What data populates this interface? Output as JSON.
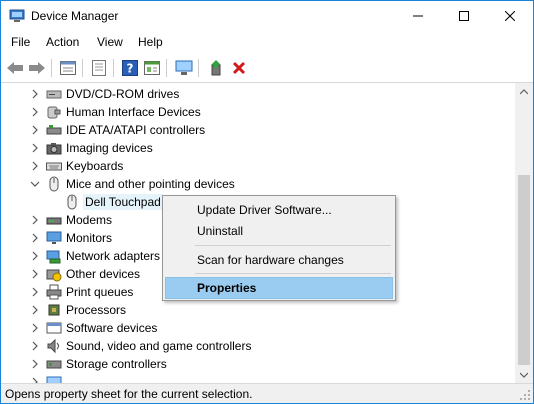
{
  "window": {
    "title": "Device Manager",
    "accent": "#1883d7"
  },
  "menubar": {
    "items": [
      "File",
      "Action",
      "View",
      "Help"
    ]
  },
  "toolbar": {
    "icons": [
      "back-arrow-icon",
      "forward-arrow-icon",
      "properties-sheet-icon",
      "device-list-icon",
      "help-icon",
      "view-icon",
      "scan-hardware-icon",
      "update-driver-icon",
      "uninstall-x-icon"
    ]
  },
  "tree": {
    "rows": [
      {
        "label": "DVD/CD-ROM drives",
        "expanded": false,
        "icon": "dvd-drive-icon"
      },
      {
        "label": "Human Interface Devices",
        "expanded": false,
        "icon": "hid-icon"
      },
      {
        "label": "IDE ATA/ATAPI controllers",
        "expanded": false,
        "icon": "ide-controller-icon"
      },
      {
        "label": "Imaging devices",
        "expanded": false,
        "icon": "camera-icon"
      },
      {
        "label": "Keyboards",
        "expanded": false,
        "icon": "keyboard-icon"
      },
      {
        "label": "Mice and other pointing devices",
        "expanded": true,
        "icon": "mouse-icon"
      },
      {
        "label": "Dell Touchpad",
        "child": true,
        "selected": true,
        "icon": "mouse-icon"
      },
      {
        "label": "Modems",
        "expanded": false,
        "icon": "modem-icon"
      },
      {
        "label": "Monitors",
        "expanded": false,
        "icon": "monitor-icon"
      },
      {
        "label": "Network adapters",
        "expanded": false,
        "icon": "network-adapter-icon"
      },
      {
        "label": "Other devices",
        "expanded": false,
        "icon": "other-devices-icon"
      },
      {
        "label": "Print queues",
        "expanded": false,
        "icon": "printer-icon"
      },
      {
        "label": "Processors",
        "expanded": false,
        "icon": "processor-icon"
      },
      {
        "label": "Software devices",
        "expanded": false,
        "icon": "software-device-icon"
      },
      {
        "label": "Sound, video and game controllers",
        "expanded": false,
        "icon": "speaker-icon"
      },
      {
        "label": "Storage controllers",
        "expanded": false,
        "icon": "storage-controller-icon"
      }
    ]
  },
  "context_menu": {
    "items": [
      {
        "label": "Update Driver Software..."
      },
      {
        "label": "Uninstall"
      },
      {
        "label": "Scan for hardware changes"
      },
      {
        "label": "Properties",
        "highlighted": true,
        "bold": true
      }
    ]
  },
  "statusbar": {
    "text": "Opens property sheet for the current selection."
  }
}
